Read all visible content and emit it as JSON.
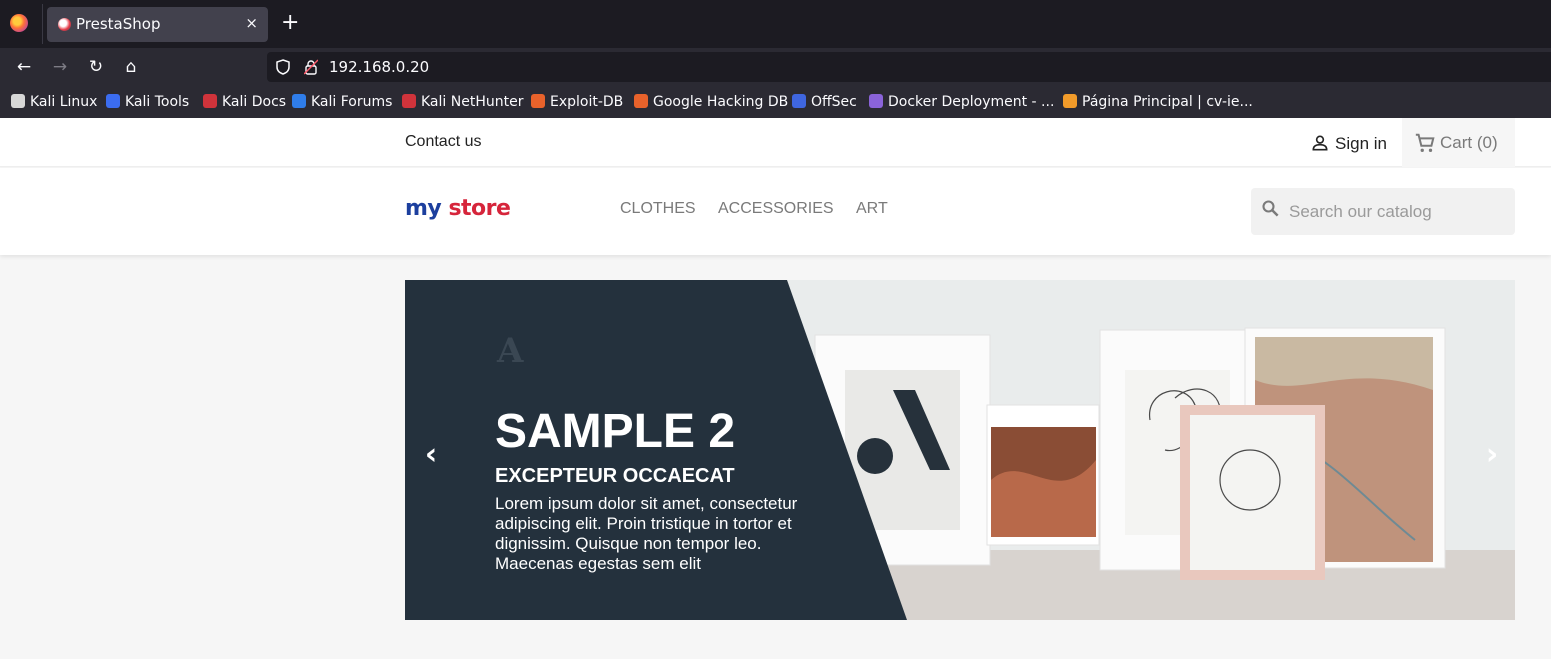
{
  "browser": {
    "tab": {
      "title": "PrestaShop",
      "close": "×"
    },
    "new_tab": "+",
    "url": "192.168.0.20",
    "nav": {
      "back": "←",
      "forward": "→",
      "reload": "↻",
      "home": "⌂"
    },
    "bookmarks": [
      {
        "label": "Kali Linux",
        "icon": "kali-dragon-icon",
        "color": "#d7d7d7"
      },
      {
        "label": "Kali Tools",
        "icon": "kali-tools-icon",
        "color": "#3b6cf0"
      },
      {
        "label": "Kali Docs",
        "icon": "kali-docs-icon",
        "color": "#d0333b"
      },
      {
        "label": "Kali Forums",
        "icon": "kali-forums-icon",
        "color": "#2f7dea"
      },
      {
        "label": "Kali NetHunter",
        "icon": "nethunter-icon",
        "color": "#d0333b"
      },
      {
        "label": "Exploit-DB",
        "icon": "exploit-db-icon",
        "color": "#e8622b"
      },
      {
        "label": "Google Hacking DB",
        "icon": "ghdb-icon",
        "color": "#e8622b"
      },
      {
        "label": "OffSec",
        "icon": "offsec-icon",
        "color": "#3f66e0"
      },
      {
        "label": "Docker Deployment - ...",
        "icon": "docker-icon",
        "color": "#8a63d9"
      },
      {
        "label": "Página Principal | cv-ie...",
        "icon": "cv-icon",
        "color": "#f29b2a"
      }
    ]
  },
  "store": {
    "contact": "Contact us",
    "sign_in": "Sign in",
    "cart": "Cart (0)",
    "logo": {
      "word1": "my",
      "word2": "store"
    },
    "menu": [
      "Clothes",
      "Accessories",
      "Art"
    ],
    "search": {
      "placeholder": "Search our catalog"
    }
  },
  "carousel": {
    "title": "SAMPLE 2",
    "subtitle": "EXCEPTEUR OCCAECAT",
    "description": "Lorem ipsum dolor sit amet, consectetur adipiscing elit. Proin tristique in tortor et dignissim. Quisque non tempor leo. Maecenas egestas sem elit",
    "prev": "‹",
    "next": "›",
    "panel_color": "#24313d"
  }
}
